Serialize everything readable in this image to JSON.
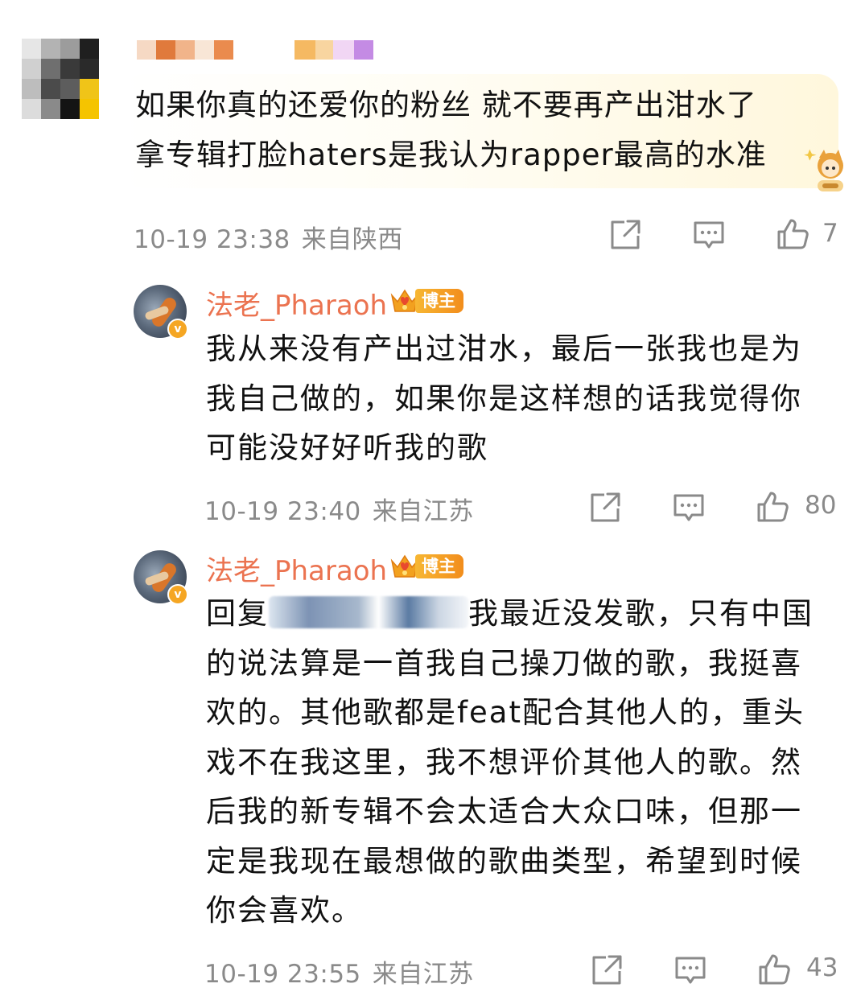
{
  "main_comment": {
    "text_lines": [
      "如果你真的还爱你的粉丝 就不要再产出泔水了",
      "拿专辑打脸haters是我认为rapper最高的水准"
    ],
    "time": "10-19 23:38",
    "location": "来自陕西",
    "likes": "7"
  },
  "replies": [
    {
      "username": "法老_Pharaoh",
      "badge": "博主",
      "verified_mark": "v",
      "text_lines": [
        "我从来没有产出过泔水，最后一张我也是为",
        "我自己做的，如果你是这样想的话我觉得你",
        "可能没好好听我的歌"
      ],
      "time": "10-19 23:40",
      "location": "来自江苏",
      "likes": "80"
    },
    {
      "username": "法老_Pharaoh",
      "badge": "博主",
      "verified_mark": "v",
      "reply_prefix": "回复",
      "first_line_rest": "我最近没发歌，只有中国",
      "text_lines": [
        "的说法算是一首我自己操刀做的歌，我挺喜",
        "欢的。其他歌都是feat配合其他人的，重头",
        "戏不在我这里，我不想评价其他人的歌。然",
        "后我的新专辑不会太适合大众口味，但那一",
        "定是我现在最想做的歌曲类型，希望到时候",
        "你会喜欢。"
      ],
      "time": "10-19 23:55",
      "location": "来自江苏",
      "likes": "43"
    }
  ],
  "icons": [
    "share-icon",
    "comment-icon",
    "like-icon",
    "crown-level-icon",
    "verified-icon"
  ],
  "colors": {
    "username": "#eb7350",
    "meta": "#8a8a8a",
    "badge": "#f5a623",
    "text": "#111111"
  }
}
